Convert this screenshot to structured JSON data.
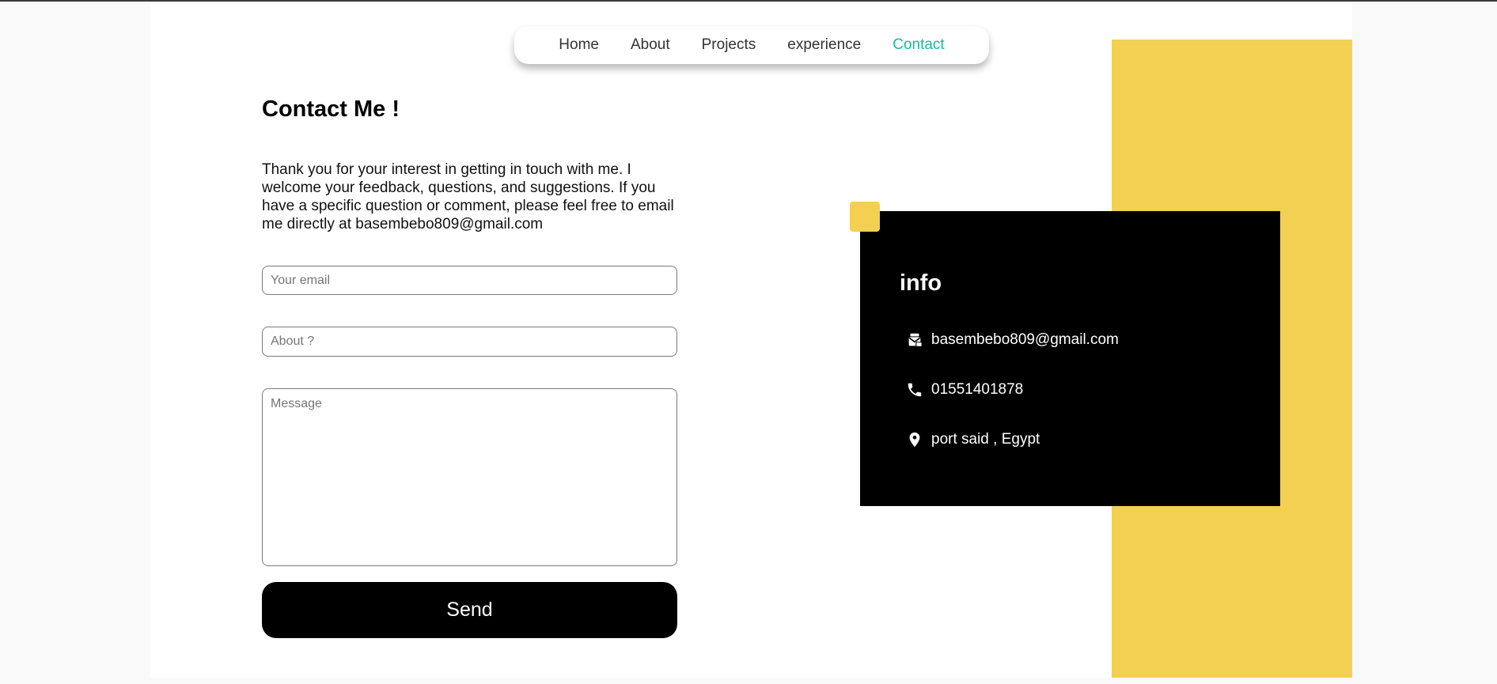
{
  "nav": {
    "items": [
      {
        "label": "Home"
      },
      {
        "label": "About"
      },
      {
        "label": "Projects"
      },
      {
        "label": "experience"
      },
      {
        "label": "Contact"
      }
    ],
    "active_index": 4,
    "active_color": "#1fb5a5"
  },
  "contact": {
    "title": "Contact Me !",
    "intro": "Thank you for your interest in getting in touch with me. I welcome your feedback, questions, and suggestions. If you have a specific question or comment, please feel free to email me directly at basembebo809@gmail.com"
  },
  "form": {
    "email_placeholder": "Your email",
    "about_placeholder": "About ?",
    "message_placeholder": "Message",
    "send_label": "Send"
  },
  "info": {
    "title": "info",
    "email": "basembebo809@gmail.com",
    "email_icon": "envelope-stack-icon",
    "phone": "01551401878",
    "phone_icon": "phone-icon",
    "location": "port said , Egypt",
    "location_icon": "location-pin-icon"
  },
  "colors": {
    "accent_yellow": "#f4d052",
    "card_background": "#000000",
    "button_background": "#000000"
  }
}
